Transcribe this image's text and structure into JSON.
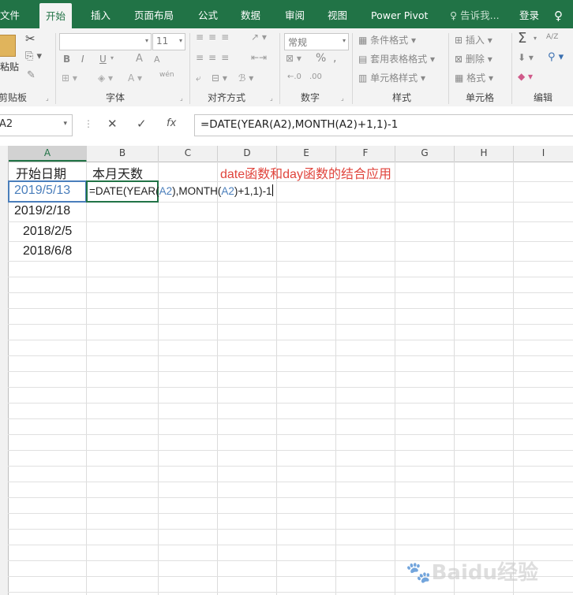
{
  "tabs": [
    "文件",
    "开始",
    "插入",
    "页面布局",
    "公式",
    "数据",
    "审阅",
    "视图",
    "Power Pivot",
    "告诉我...",
    "登录"
  ],
  "active_tab": "开始",
  "ribbon": {
    "clipboard": {
      "label": "剪贴板",
      "paste": "粘贴"
    },
    "font": {
      "label": "字体",
      "size": "11",
      "bold": "B",
      "italic": "I",
      "underline": "U",
      "grow": "A",
      "shrink": "A",
      "phonetic": "wén"
    },
    "alignment": {
      "label": "对齐方式"
    },
    "number": {
      "label": "数字",
      "format": "常规",
      "percent": "%",
      "comma": ",",
      "inc_dec": "←.0",
      "dec_dec": ".00"
    },
    "styles": {
      "label": "样式",
      "conditional": "条件格式",
      "table": "套用表格格式",
      "cell": "单元格样式"
    },
    "cells": {
      "label": "单元格",
      "insert": "插入",
      "delete": "删除",
      "format": "格式"
    },
    "editing": {
      "label": "编辑",
      "sum": "Σ",
      "sort": "A/Z"
    }
  },
  "formula_bar": {
    "name_box": "A2",
    "cancel": "✕",
    "enter": "✓",
    "fx": "fx",
    "formula": "=DATE(YEAR(A2),MONTH(A2)+1,1)-1"
  },
  "columns": [
    "A",
    "B",
    "C",
    "D",
    "E",
    "F",
    "G",
    "H",
    "I"
  ],
  "cells": {
    "A1": "开始日期",
    "B1": "本月天数",
    "D1": "date函数和day函数的结合应用",
    "A2": "2019/5/13",
    "A3": "2019/2/18",
    "A4": "2018/2/5",
    "A5": "2018/6/8",
    "B2_parts": [
      "=",
      "DATE(YEAR(",
      "A2",
      "),MONTH(",
      "A2",
      ")+1,1)-1"
    ]
  },
  "watermark": "Baidu经验",
  "colors": {
    "excel_green": "#217346",
    "ref_blue": "#4a7ebb",
    "title_red": "#e0443c"
  }
}
